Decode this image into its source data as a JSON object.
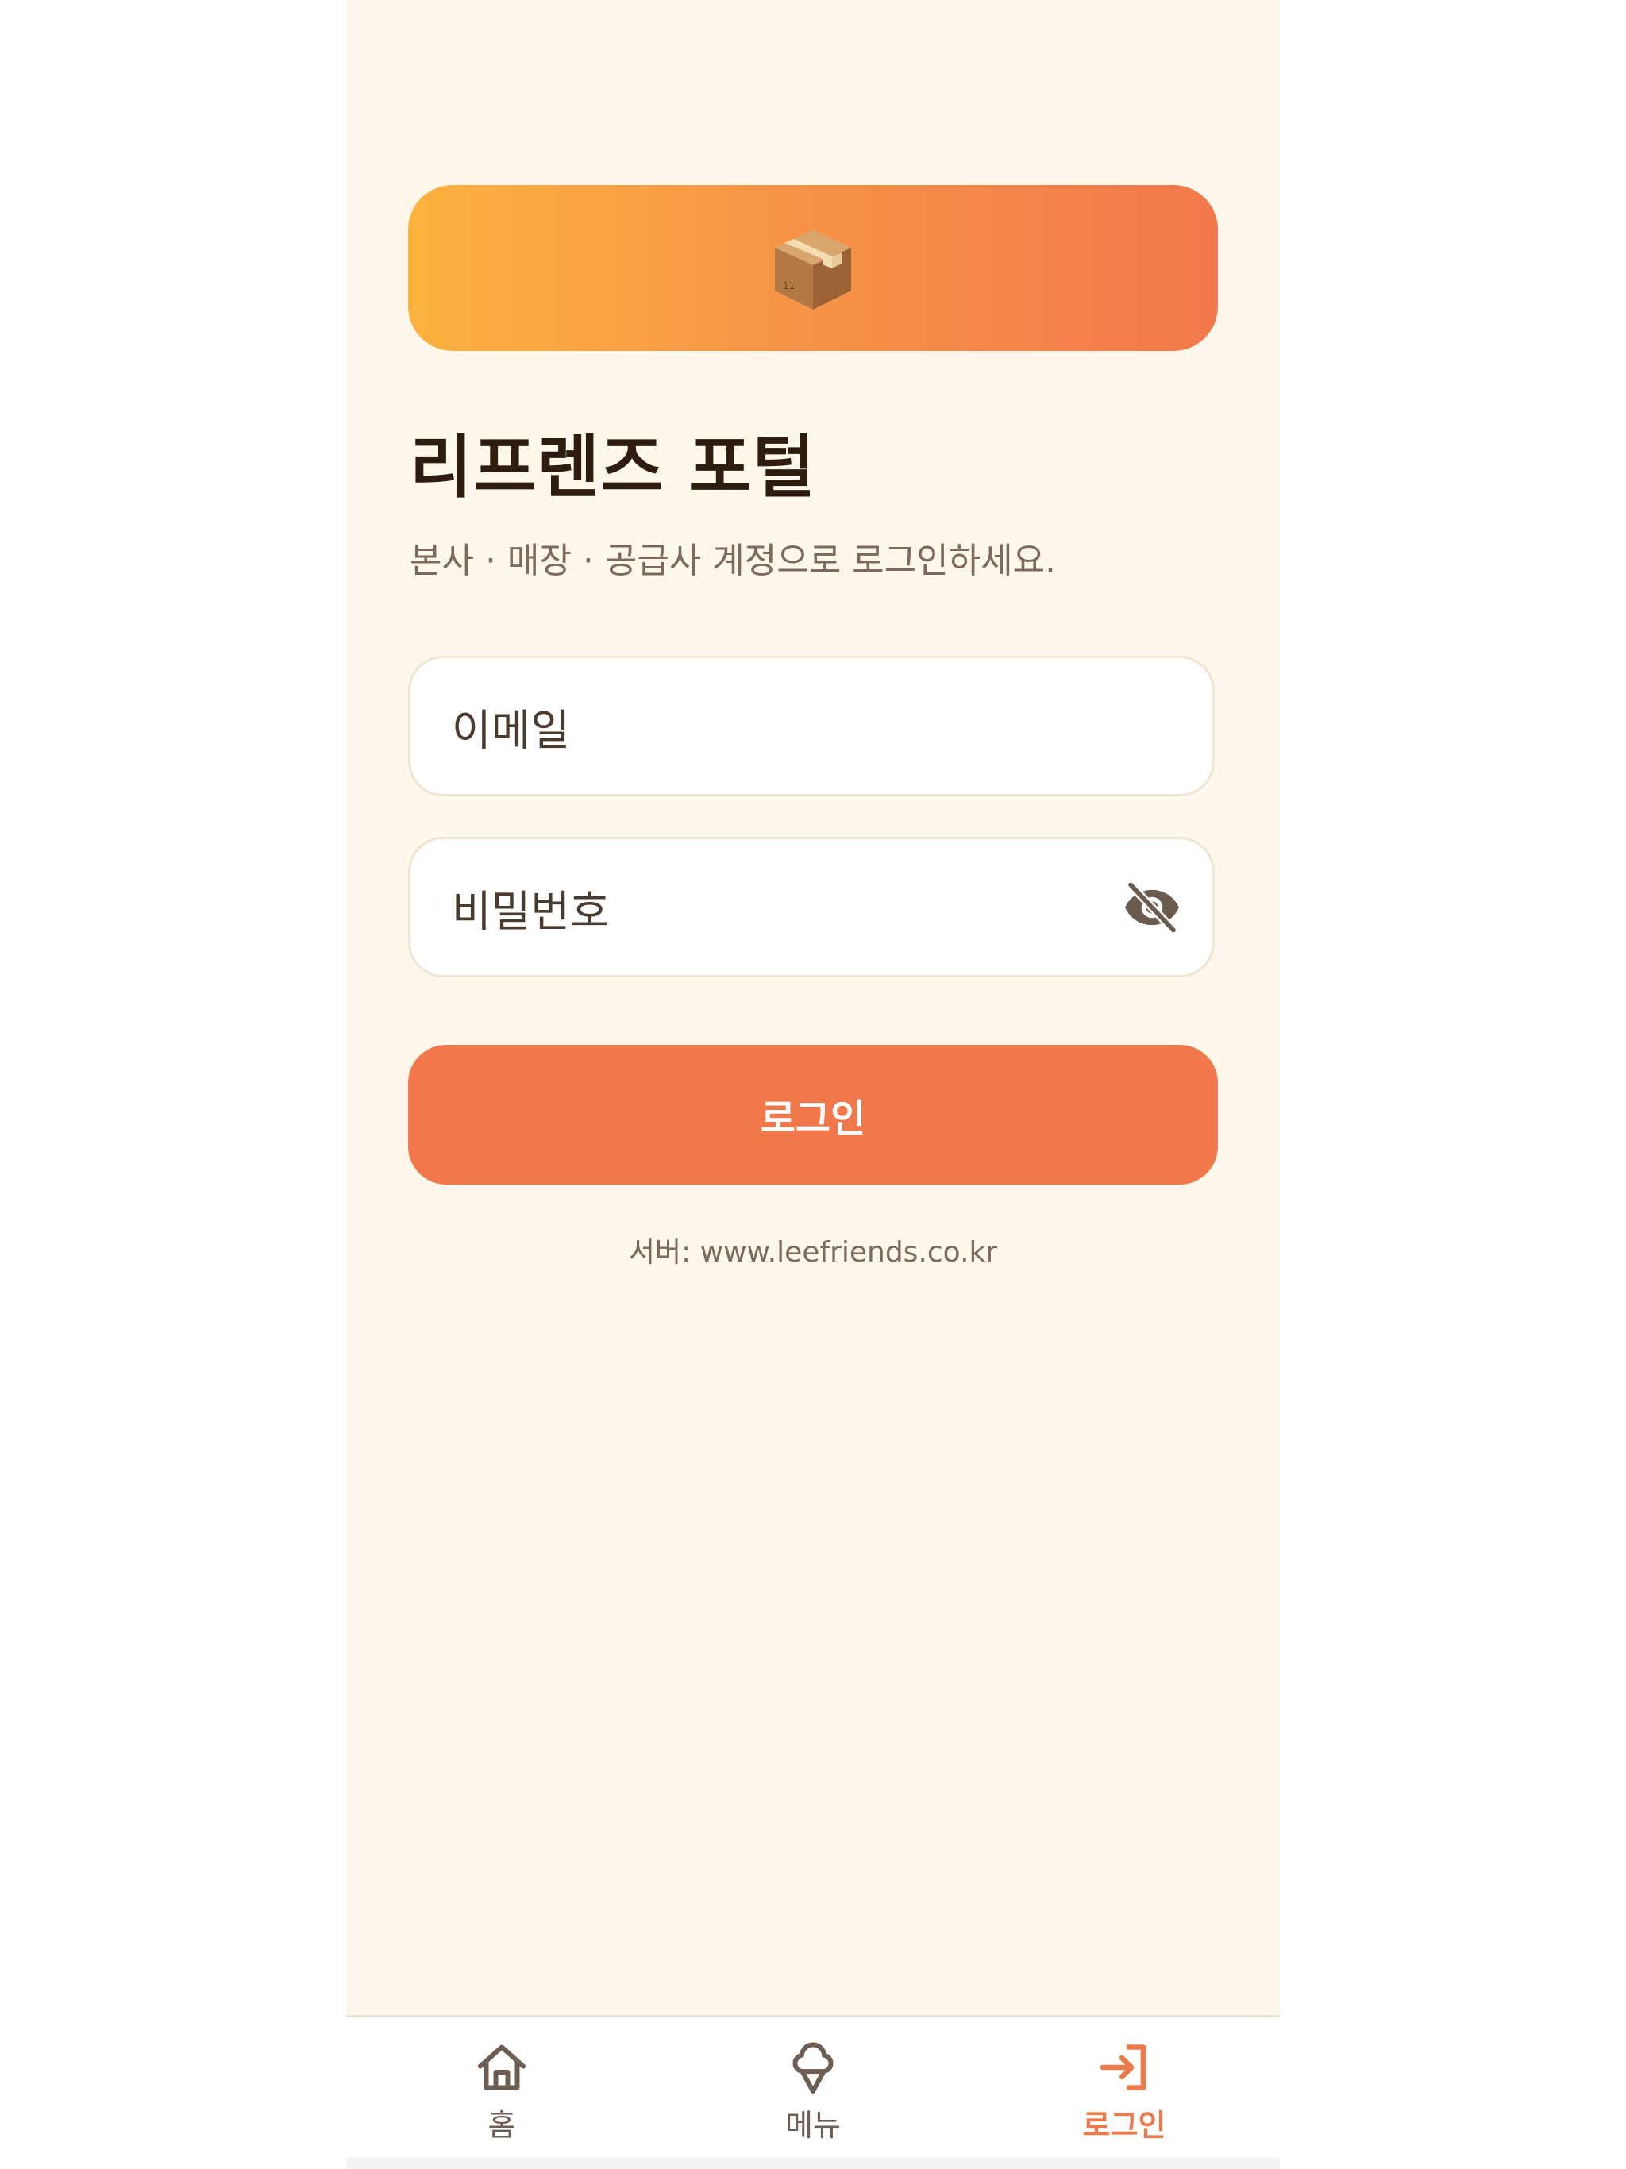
{
  "app": {
    "hero_icon": "package-box-icon",
    "title": "리프렌즈 포털",
    "subtitle": "본사 · 매장 · 공급사 계정으로 로그인하세요."
  },
  "form": {
    "email_placeholder": "이메일",
    "password_placeholder": "비밀번호",
    "password_toggle_icon": "eye-off-icon",
    "login_button": "로그인",
    "server_text": "서버: www.leefriends.co.kr"
  },
  "nav": {
    "items": [
      {
        "label": "홈",
        "icon": "home-icon",
        "active": false
      },
      {
        "label": "메뉴",
        "icon": "ice-cream-icon",
        "active": false
      },
      {
        "label": "로그인",
        "icon": "login-icon",
        "active": true
      }
    ]
  },
  "colors": {
    "background": "#fdf7ec",
    "accent": "#f1784b",
    "gradient_start": "#fdb240",
    "gradient_end": "#f2784b",
    "title": "#2e1d0e",
    "muted_text": "#7d6a5c"
  }
}
